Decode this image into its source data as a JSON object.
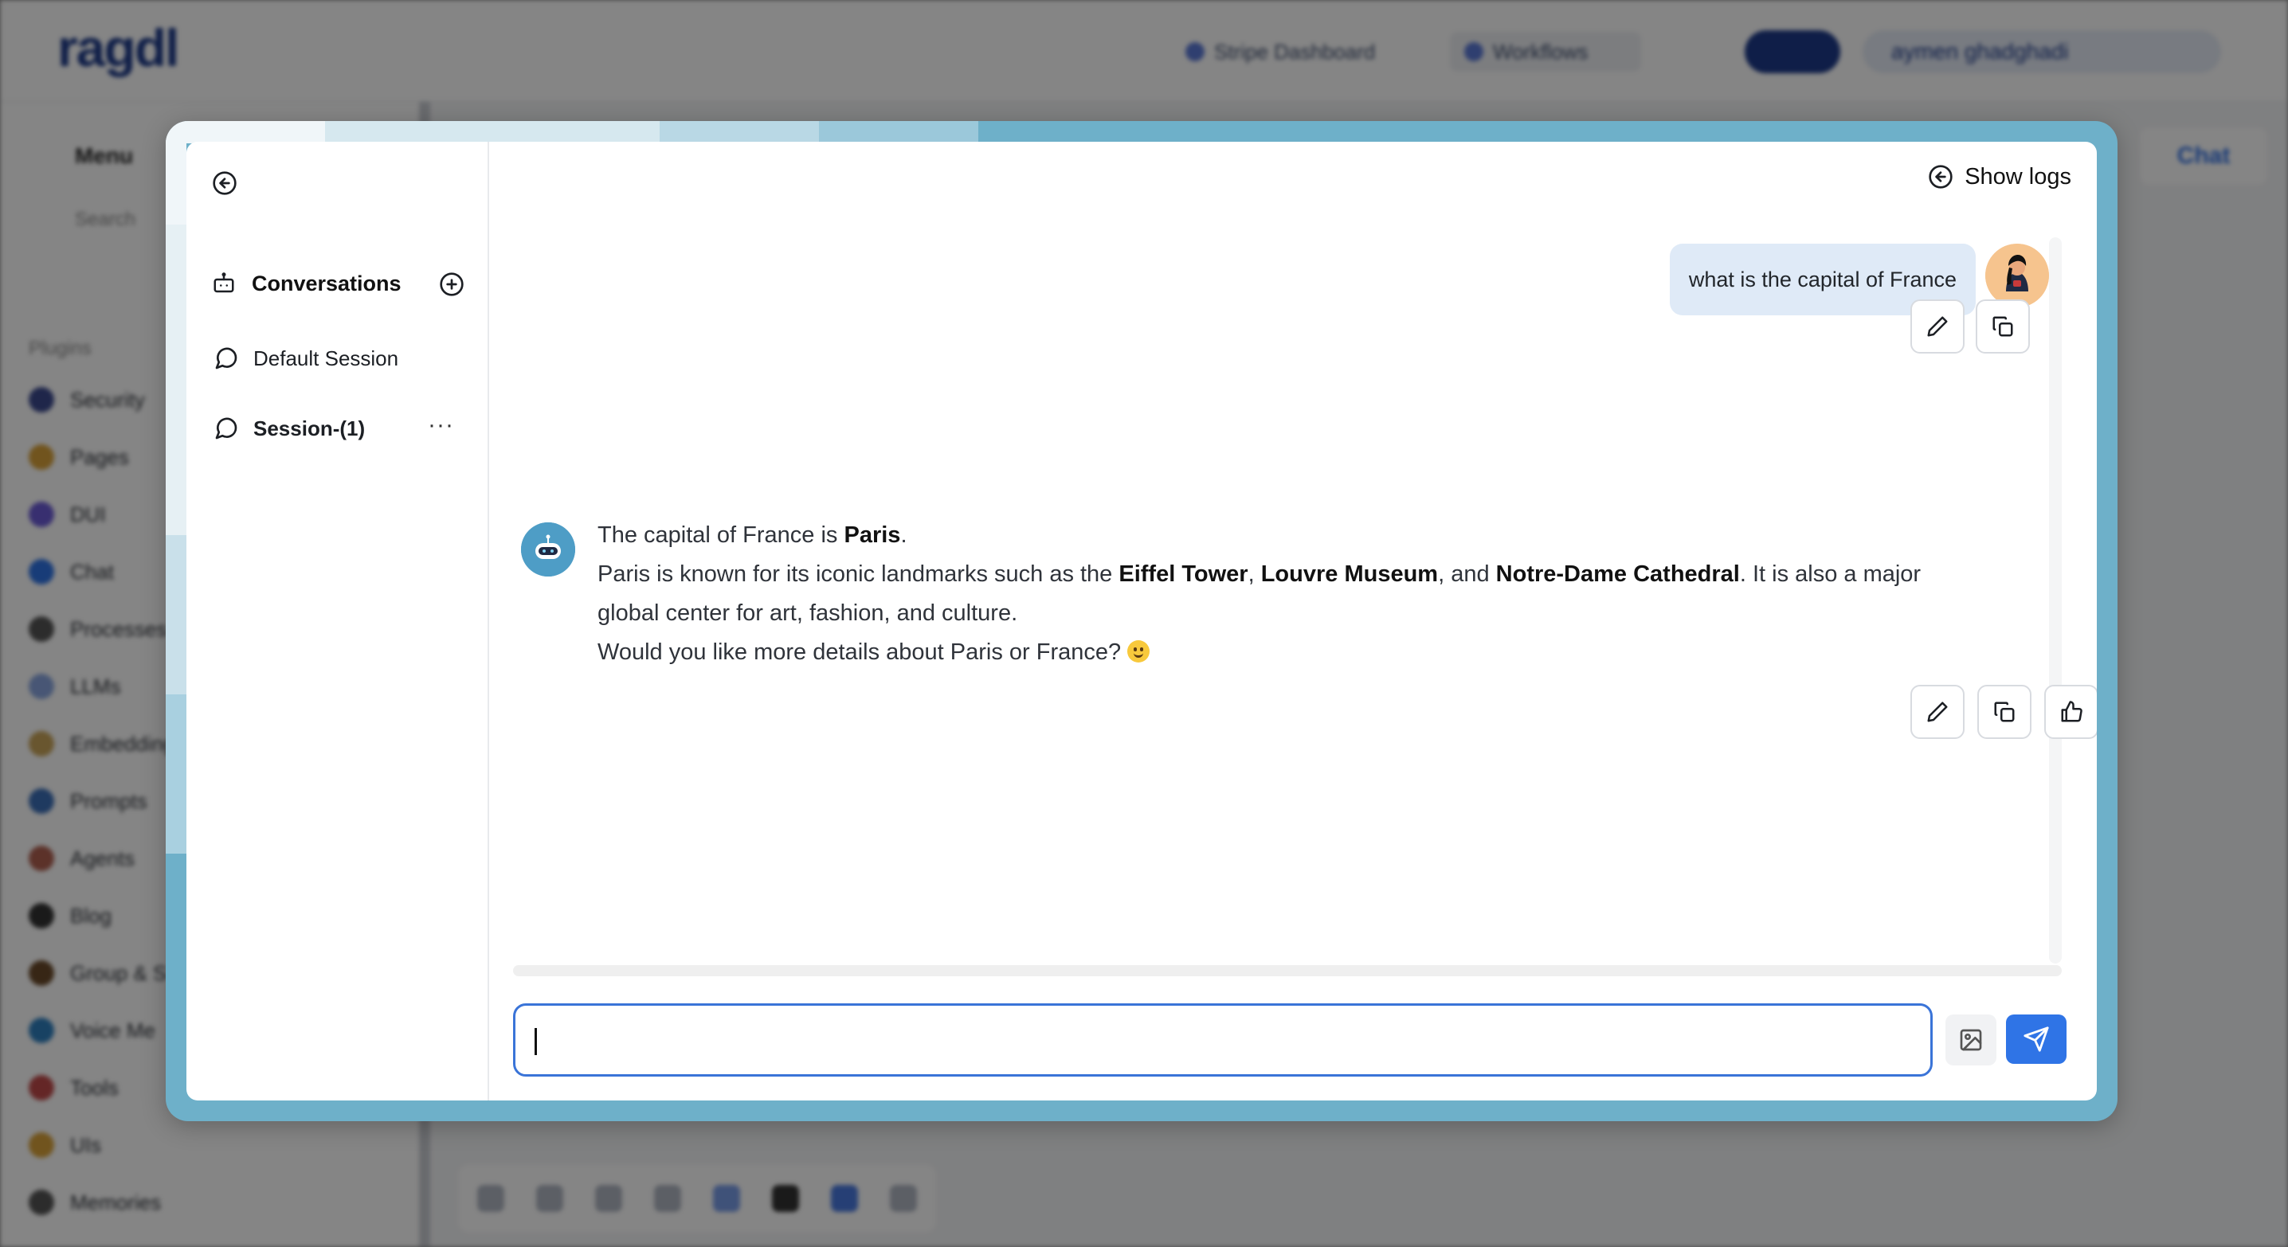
{
  "background": {
    "logo": "ragdl",
    "nav": [
      "Stripe Dashboard",
      "Workflows"
    ],
    "user": "aymen ghadghadi",
    "menu_label": "Menu",
    "search_label": "Search",
    "section_label": "Plugins",
    "sidebar_items": [
      "Security",
      "Pages",
      "DUI",
      "Chat",
      "Processes",
      "LLMs",
      "Embeddings",
      "Prompts",
      "Agents",
      "Blog",
      "Group & S",
      "Voice Me",
      "Tools",
      "UIs",
      "Memories"
    ],
    "chat_button": "Chat"
  },
  "modal": {
    "left_panel": {
      "back_icon": "arrow-left-circle-icon",
      "conversations_title": "Conversations",
      "sessions": [
        {
          "label": "Default Session",
          "active": false
        },
        {
          "label": "Session-(1)",
          "active": true
        }
      ],
      "more_label": "···"
    },
    "header": {
      "show_logs_label": "Show logs"
    },
    "messages": {
      "user": {
        "text": "what is the capital of France"
      },
      "bot": {
        "line1_pre": "The capital of France is ",
        "line1_bold": "Paris",
        "line1_post": ".",
        "line2_pre": "Paris is known for its iconic landmarks such as the ",
        "line2_b1": "Eiffel Tower",
        "line2_sep1": ", ",
        "line2_b2": "Louvre Museum",
        "line2_sep2": ", and ",
        "line2_b3": "Notre-Dame Cathedral",
        "line2_post": ". It is also a major global center for art, fashion, and culture.",
        "line3": "Would you like more details about Paris or France? "
      }
    },
    "input": {
      "value": "",
      "placeholder": ""
    },
    "colors": {
      "accent": "#2f74e6",
      "user_bubble": "#dfeaf7",
      "frame": "#6eb0c9",
      "bot_avatar": "#4e9dc6"
    }
  }
}
